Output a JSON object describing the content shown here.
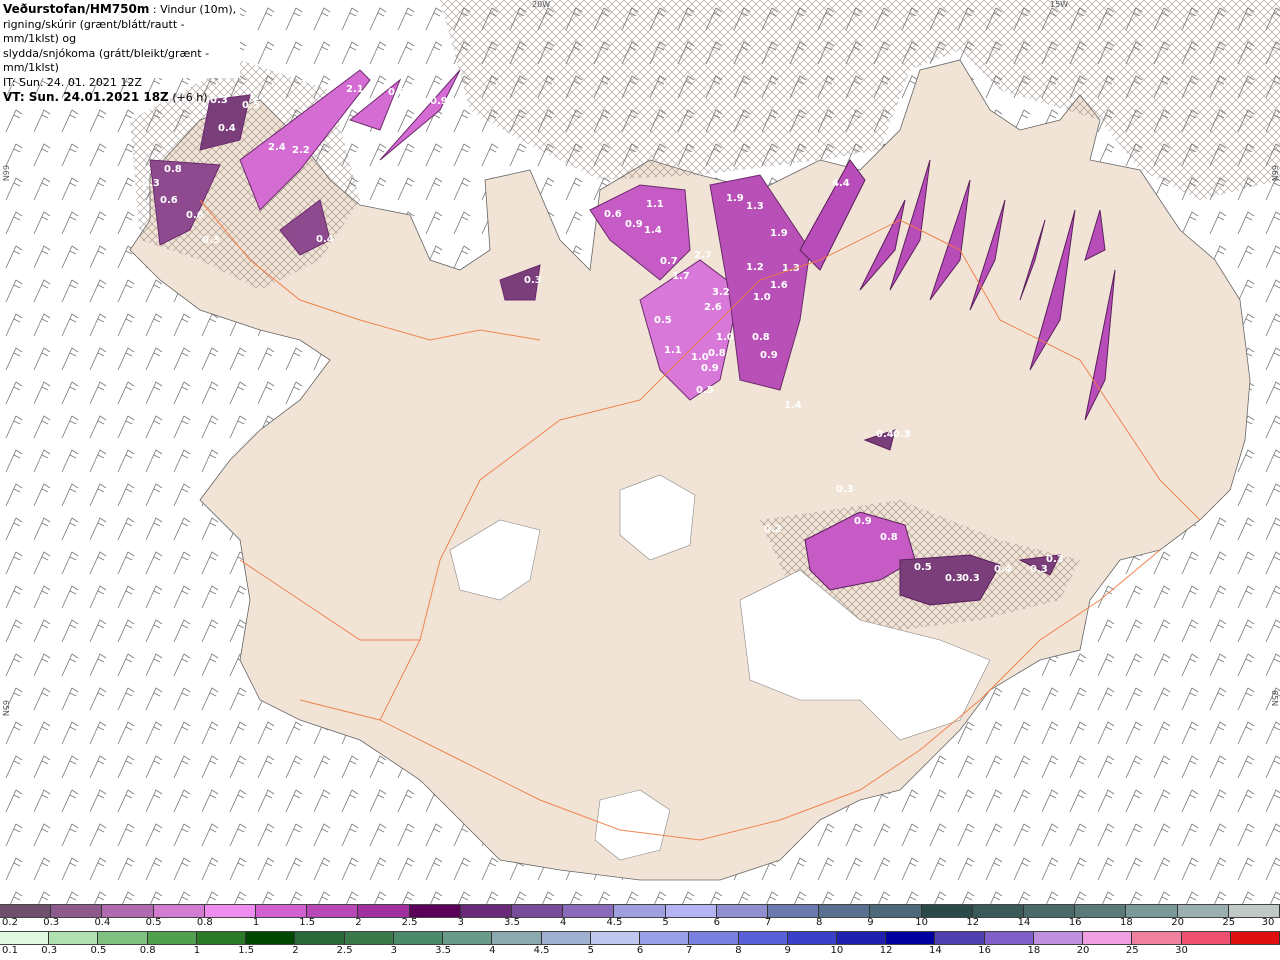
{
  "header": {
    "title": "Veðurstofan/HM750m",
    "line1_rest": " : Vindur (10m),",
    "line2": "rigning/skúrir (grænt/blátt/rautt - mm/1klst) og",
    "line3": "slydda/snjókoma (grátt/bleikt/grænt - mm/1klst)",
    "it_line": "IT: Sun. 24. 01. 2021 12Z",
    "vt_prefix": "VT: Sun. 24.01.2021 18Z",
    "vt_suffix": " (+6 h)"
  },
  "grid_labels": {
    "top_20w": "20W",
    "top_15w": "15W",
    "left_66n": "66N",
    "right_66n": "66N",
    "left_65n": "65N",
    "right_65n": "65N"
  },
  "map_values": [
    {
      "label": "2.1"
    },
    {
      "label": "0.8"
    },
    {
      "label": "0.9"
    },
    {
      "label": "0.3"
    },
    {
      "label": "0.5"
    },
    {
      "label": "0.4"
    },
    {
      "label": "2.4"
    },
    {
      "label": "2.2"
    },
    {
      "label": "0.8"
    },
    {
      "label": "0.3"
    },
    {
      "label": "0.6"
    },
    {
      "label": "0.6"
    },
    {
      "label": "0.4"
    },
    {
      "label": "0.3"
    },
    {
      "label": "0.3"
    },
    {
      "label": "0.6"
    },
    {
      "label": "1.1"
    },
    {
      "label": "0.9"
    },
    {
      "label": "1.4"
    },
    {
      "label": "1.9"
    },
    {
      "label": "1.3"
    },
    {
      "label": "4.4"
    },
    {
      "label": "1.9"
    },
    {
      "label": "0.7"
    },
    {
      "label": "2.7"
    },
    {
      "label": "1.7"
    },
    {
      "label": "1.2"
    },
    {
      "label": "1.3"
    },
    {
      "label": "3.2"
    },
    {
      "label": "1.6"
    },
    {
      "label": "2.6"
    },
    {
      "label": "1.0"
    },
    {
      "label": "0.5"
    },
    {
      "label": "1.0"
    },
    {
      "label": "0.8"
    },
    {
      "label": "1.1"
    },
    {
      "label": "1.0"
    },
    {
      "label": "0.8"
    },
    {
      "label": "0.9"
    },
    {
      "label": "0.9"
    },
    {
      "label": "0.5"
    },
    {
      "label": "1.4"
    },
    {
      "label": "0.4"
    },
    {
      "label": "0.3"
    },
    {
      "label": "0.3"
    },
    {
      "label": "0.9"
    },
    {
      "label": "0.8"
    },
    {
      "label": "0.2"
    },
    {
      "label": "0.5"
    },
    {
      "label": "0.3"
    },
    {
      "label": "0.3"
    },
    {
      "label": "0.4"
    },
    {
      "label": "0.3"
    },
    {
      "label": "0.3"
    }
  ],
  "colorbar_snow": {
    "colors": [
      "#6e4f6e",
      "#8e5a8e",
      "#b06bb0",
      "#d27cd2",
      "#f08cf0",
      "#d060d0",
      "#b848b8",
      "#a030a0",
      "#5a005a",
      "#6a2a7a",
      "#7a4a9a",
      "#8a6aba",
      "#a0a0e0",
      "#b4b4f4",
      "#9090d0",
      "#6a7ab0",
      "#5a7090",
      "#4a6a7a",
      "#2a4a4a",
      "#3a5a5a",
      "#4a6a6a",
      "#5a7a7a",
      "#7a9a9a",
      "#9ab0b0",
      "#c0c8c8"
    ],
    "labels": [
      "0.2",
      "0.3",
      "0.4",
      "0.5",
      "0.8",
      "1",
      "1.5",
      "2",
      "2.5",
      "3",
      "3.5",
      "4",
      "4.5",
      "5",
      "6",
      "7",
      "8",
      "9",
      "10",
      "12",
      "14",
      "16",
      "18",
      "20",
      "25",
      "30"
    ]
  },
  "colorbar_rain": {
    "colors": [
      "#e0f8e0",
      "#b0e0b0",
      "#80c080",
      "#50a050",
      "#2a7a2a",
      "#004800",
      "#2a6a3a",
      "#3a7a4a",
      "#4a8a6a",
      "#6a9a8a",
      "#8aaab0",
      "#a0b0d0",
      "#c0c8f0",
      "#9aa0e8",
      "#7a80e0",
      "#5a60d8",
      "#3a40c8",
      "#2020b0",
      "#0000a0",
      "#5040b0",
      "#8060c8",
      "#c090e0",
      "#f0a0e0",
      "#f080a0",
      "#f05070",
      "#e01010"
    ],
    "labels": [
      "0.1",
      "0.3",
      "0.5",
      "0.8",
      "1",
      "1.5",
      "2",
      "2.5",
      "3",
      "3.5",
      "4",
      "4.5",
      "5",
      "6",
      "7",
      "8",
      "9",
      "10",
      "12",
      "14",
      "16",
      "18",
      "20",
      "25",
      "30"
    ]
  }
}
